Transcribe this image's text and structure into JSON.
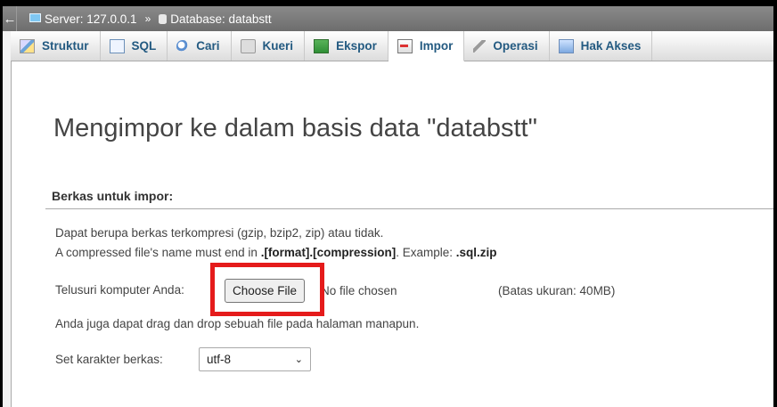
{
  "breadcrumb": {
    "collapse_glyph": "←",
    "server": "Server: 127.0.0.1",
    "separator": "»",
    "database": "Database: databstt"
  },
  "tabs": [
    {
      "label": "Struktur",
      "icon": "structure-icon"
    },
    {
      "label": "SQL",
      "icon": "sql-icon"
    },
    {
      "label": "Cari",
      "icon": "search-icon"
    },
    {
      "label": "Kueri",
      "icon": "query-icon"
    },
    {
      "label": "Ekspor",
      "icon": "export-icon"
    },
    {
      "label": "Impor",
      "icon": "import-icon",
      "active": true
    },
    {
      "label": "Operasi",
      "icon": "wrench-icon"
    },
    {
      "label": "Hak Akses",
      "icon": "privileges-icon"
    }
  ],
  "main": {
    "title": "Mengimpor ke dalam basis data \"databstt\"",
    "section_legend": "Berkas untuk impor:",
    "compress_note": "Dapat berupa berkas terkompresi (gzip, bzip2, zip) atau tidak.",
    "name_note_prefix": "A compressed file's name must end in ",
    "name_note_format": ".[format].[compression]",
    "name_note_mid": ". Example: ",
    "name_note_example": ".sql.zip",
    "browse_label": "Telusuri komputer Anda:",
    "choose_file_button": "Choose File",
    "no_file_text": "No file chosen",
    "size_limit": "(Batas ukuran: 40MB)",
    "drag_note": "Anda juga dapat drag dan drop sebuah file pada halaman manapun.",
    "charset_label": "Set karakter berkas:",
    "charset_value": "utf-8"
  },
  "colors": {
    "highlight_box": "#e51b1b",
    "tab_text": "#235a81",
    "breadcrumb_bg": "#7a7a7a"
  }
}
